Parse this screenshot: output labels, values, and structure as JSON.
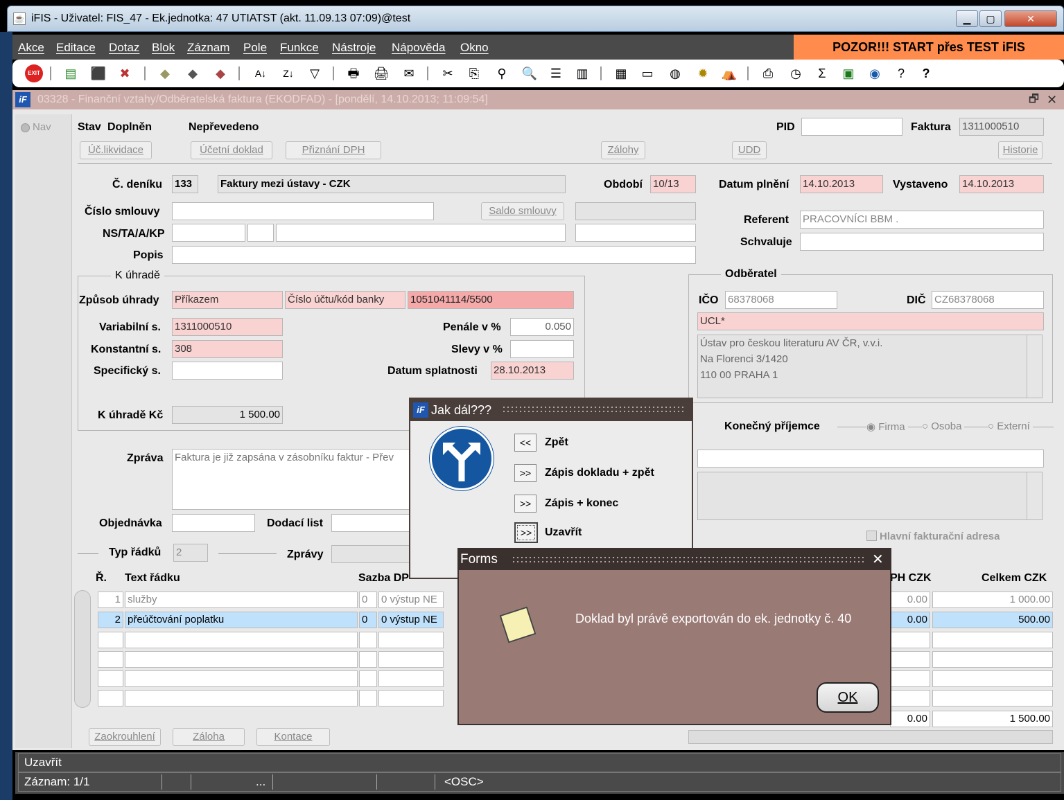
{
  "window": {
    "title": "iFIS - Uživatel: FIS_47 - Ek.jednotka: 47 UTIATST (akt. 11.09.13 07:09)@test",
    "min": "▁",
    "max": "▢",
    "close": "✕"
  },
  "menu": [
    "Akce",
    "Editace",
    "Dotaz",
    "Blok",
    "Záznam",
    "Pole",
    "Funkce",
    "Nástroje",
    "Nápověda",
    "Okno"
  ],
  "banner": "POZOR!!!  START přes TEST iFIS",
  "toolbar": {
    "exit": "EXIT"
  },
  "form": {
    "title": "03328 - Finanční vztahy/Odběratelská faktura (EKODFAD) - [pondělí, 14.10.2013; 11:09:54]",
    "restore": "🗗",
    "close": "✕"
  },
  "nav": "Nav",
  "header": {
    "stav": "Stav",
    "doplnen": "Doplněn",
    "neprevedeno": "Nepřevedeno",
    "pid_label": "PID",
    "pid": "",
    "faktura_label": "Faktura",
    "faktura": "1311000510"
  },
  "buttons": {
    "uc_likvidace": "Úč.likvidace",
    "ucetni_doklad": "Účetní doklad",
    "priznani_dph": "Přiznání DPH",
    "zalohy": "Zálohy",
    "udd": "UDD",
    "historie": "Historie",
    "saldo": "Saldo smlouvy",
    "zaokrouhleni": "Zaokrouhlení",
    "zaloha": "Záloha",
    "kontace": "Kontace"
  },
  "fields": {
    "c_deniku_label": "Č. deníku",
    "c_deniku": "133",
    "c_deniku_text": "Faktury mezi ústavy - CZK",
    "obdobi_label": "Období",
    "obdobi": "10/13",
    "datum_plneni_label": "Datum plnění",
    "datum_plneni": "14.10.2013",
    "vystaveno_label": "Vystaveno",
    "vystaveno": "14.10.2013",
    "cislo_smlouvy_label": "Číslo smlouvy",
    "ns_label": "NS/TA/A/KP",
    "popis_label": "Popis",
    "referent_label": "Referent",
    "referent": "PRACOVNÍCI BBM .",
    "schvaluje_label": "Schvaluje"
  },
  "uhrada": {
    "group": "K úhradě",
    "zpusob_label": "Způsob úhrady",
    "zpusob": "Příkazem",
    "ucet_label": "Číslo účtu/kód banky",
    "ucet": "1051041114/5500",
    "vs_label": "Variabilní s.",
    "vs": "1311000510",
    "ks_label": "Konstantní s.",
    "ks": "308",
    "ss_label": "Specifický s.",
    "penale_label": "Penále v %",
    "penale": "0.050",
    "slevy_label": "Slevy v %",
    "splatnost_label": "Datum splatnosti",
    "splatnost": "28.10.2013",
    "k_uhrade_label": "K úhradě Kč",
    "k_uhrade": "1 500.00"
  },
  "odberatel": {
    "group": "Odběratel",
    "ico_label": "IČO",
    "ico": "68378068",
    "dic_label": "DIČ",
    "dic": "CZ68378068",
    "kod": "UCL*",
    "adresa1": "Ústav pro českou literaturu AV ČR, v.v.i.",
    "adresa2": "Na Florenci 3/1420",
    "adresa3": "110 00 PRAHA 1"
  },
  "prijemce": {
    "label": "Konečný příjemce",
    "firma": "Firma",
    "osoba": "Osoba",
    "externi": "Externí",
    "hlavni": "Hlavní fakturační adresa"
  },
  "lower": {
    "zprava_label": "Zpráva",
    "zprava": "Faktura je již zapsána v zásobníku faktur - Přev",
    "objednavka_label": "Objednávka",
    "dodaci_label": "Dodací list",
    "typ_label": "Typ řádků",
    "typ": "2",
    "zpravy_label": "Zprávy"
  },
  "table": {
    "headers": {
      "r": "Ř.",
      "text": "Text řádku",
      "sazba": "Sazba DP",
      "dph": "PH CZK",
      "celkem": "Celkem CZK"
    },
    "rows": [
      {
        "n": "1",
        "text": "služby",
        "s": "0",
        "v": "0 výstup NE",
        "dph": "0.00",
        "celkem": "1 000.00"
      },
      {
        "n": "2",
        "text": "přeúčtování poplatku",
        "s": "0",
        "v": "0 výstup NE",
        "dph": "0.00",
        "celkem": "500.00"
      }
    ],
    "total_dph": "0.00",
    "total": "1 500.00"
  },
  "dialog1": {
    "title": "Jak dál???",
    "opt1_btn": "<<",
    "opt1": "Zpět",
    "opt2_btn": ">>",
    "opt2": "Zápis dokladu + zpět",
    "opt3_btn": ">>",
    "opt3": "Zápis + konec",
    "opt4_btn": ">>",
    "opt4": "Uzavřít"
  },
  "dialog2": {
    "title": "Forms",
    "close": "✕",
    "message": "Doklad byl právě exportován do ek. jednotky č. 40",
    "ok": "OK"
  },
  "status": {
    "line1": "Uzavřít",
    "line2": "Záznam: 1/1",
    "dots": "...",
    "osc": "<OSC>"
  }
}
